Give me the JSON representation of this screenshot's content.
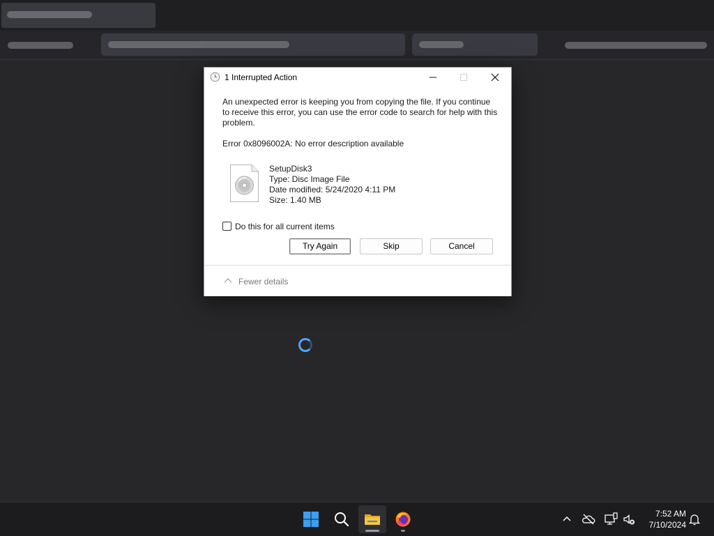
{
  "dialog": {
    "title": "1 Interrupted Action",
    "message": "An unexpected error is keeping you from copying the file. If you continue to receive this error, you can use the error code to search for help with this problem.",
    "error_text": "Error 0x8096002A: No error description available",
    "file": {
      "name": "SetupDisk3",
      "type": "Type: Disc Image File",
      "date_modified": "Date modified: 5/24/2020 4:11 PM",
      "size": "Size: 1.40 MB"
    },
    "checkbox_label": "Do this for all current items",
    "checkbox_checked": false,
    "buttons": {
      "try_again": "Try Again",
      "skip": "Skip",
      "cancel": "Cancel"
    },
    "details_toggle": "Fewer details"
  },
  "taskbar": {
    "time": "7:52 AM",
    "date": "7/10/2024",
    "apps": [
      "start-icon",
      "search-icon",
      "file-explorer-icon",
      "firefox-icon"
    ],
    "tray": [
      "chevron-up-icon",
      "onedrive-icon",
      "network-icon",
      "volume-muted-icon",
      "notification-bell-icon"
    ]
  },
  "colors": {
    "accent": "#4ea6ff",
    "start_blue": "#3aa0f3",
    "folder_yellow": "#f5c542"
  }
}
